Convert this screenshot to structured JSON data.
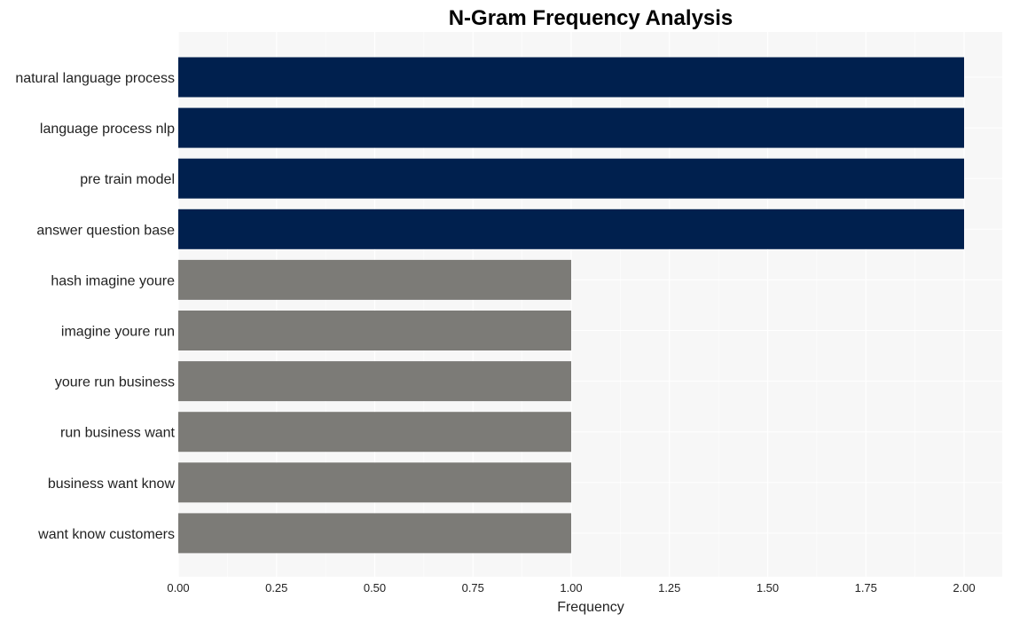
{
  "chart_data": {
    "type": "bar",
    "orientation": "horizontal",
    "title": "N-Gram Frequency Analysis",
    "xlabel": "Frequency",
    "ylabel": "",
    "xlim": [
      0,
      2.1
    ],
    "xticks": [
      "0.00",
      "0.25",
      "0.50",
      "0.75",
      "1.00",
      "1.25",
      "1.50",
      "1.75",
      "2.00"
    ],
    "grid": true,
    "legend": "none",
    "categories": [
      "natural language process",
      "language process nlp",
      "pre train model",
      "answer question base",
      "hash imagine youre",
      "imagine youre run",
      "youre run business",
      "run business want",
      "business want know",
      "want know customers"
    ],
    "values": [
      2,
      2,
      2,
      2,
      1,
      1,
      1,
      1,
      1,
      1
    ],
    "colors": {
      "high": "#00204e",
      "low": "#7c7b77",
      "plot_background": "#f7f7f7",
      "grid": "#ffffff"
    }
  }
}
